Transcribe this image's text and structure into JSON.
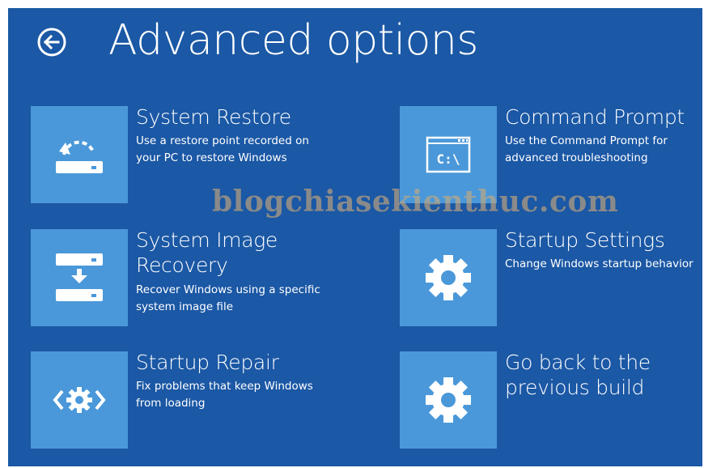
{
  "page": {
    "title": "Advanced options"
  },
  "colors": {
    "background": "#1b58a5",
    "tile": "#4a98d9",
    "text": "#ffffff"
  },
  "watermark": "blogchiasekienthuc.com",
  "options": {
    "system_restore": {
      "title": "System Restore",
      "description": "Use a restore point recorded on your PC to restore Windows",
      "icon": "restore-icon"
    },
    "command_prompt": {
      "title": "Command Prompt",
      "description": "Use the Command Prompt for advanced troubleshooting",
      "icon_text": "C:\\",
      "icon": "command-prompt-icon"
    },
    "system_image_recovery": {
      "title": "System Image Recovery",
      "description": "Recover Windows using a specific system image file",
      "icon": "image-recovery-icon"
    },
    "startup_settings": {
      "title": "Startup Settings",
      "description": "Change Windows startup behavior",
      "icon": "gear-icon"
    },
    "startup_repair": {
      "title": "Startup Repair",
      "description": "Fix problems that keep Windows from loading",
      "icon": "startup-repair-icon"
    },
    "go_back": {
      "title": "Go back to the previous build",
      "description": "",
      "icon": "gear-icon"
    }
  }
}
